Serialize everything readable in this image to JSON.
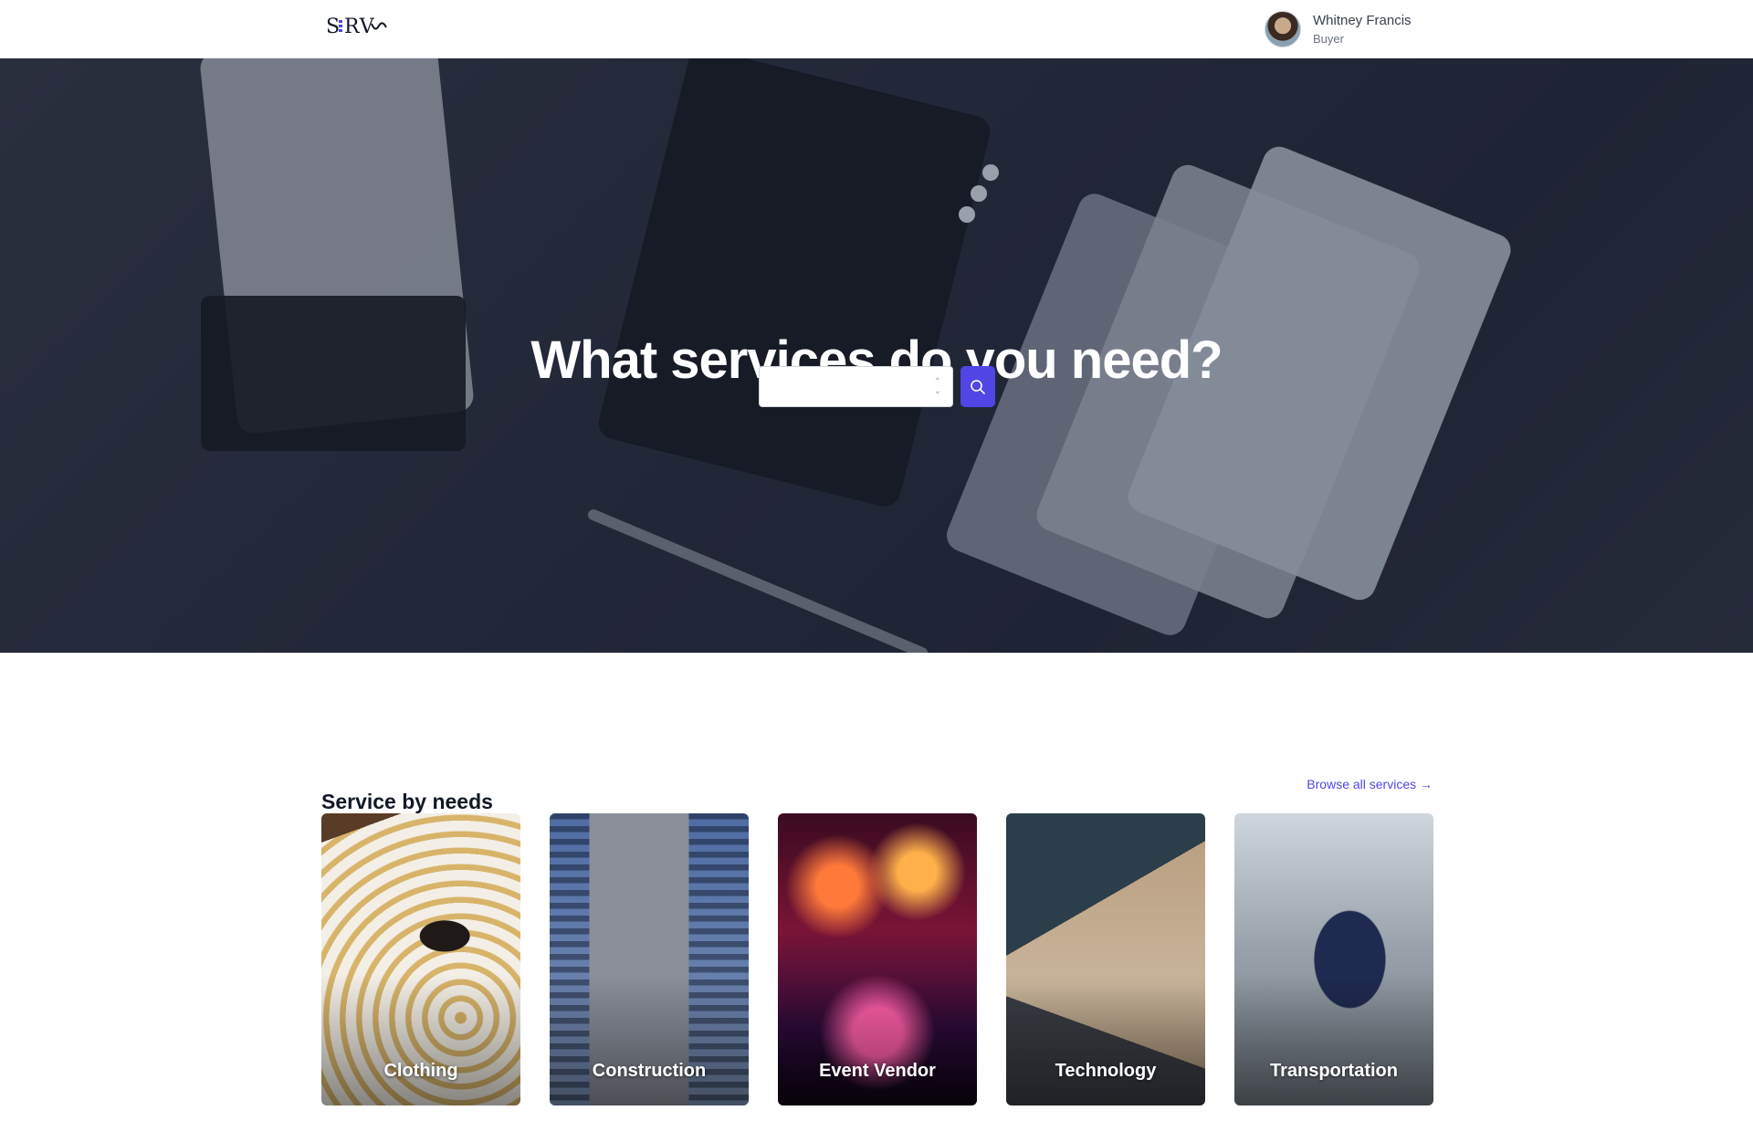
{
  "header": {
    "logo_text": "SERVes",
    "user": {
      "name": "Whitney Francis",
      "role": "Buyer"
    }
  },
  "hero": {
    "title": "What services do you need?",
    "search": {
      "selected_value": "",
      "button_icon": "search-icon"
    }
  },
  "services": {
    "title": "Service by needs",
    "browse_link": "Browse all services →",
    "categories": [
      {
        "label": "Clothing"
      },
      {
        "label": "Construction"
      },
      {
        "label": "Event Vendor"
      },
      {
        "label": "Technology"
      },
      {
        "label": "Transportation"
      }
    ]
  },
  "colors": {
    "accent": "#4f46e5",
    "hero_overlay": "#1f2434"
  }
}
